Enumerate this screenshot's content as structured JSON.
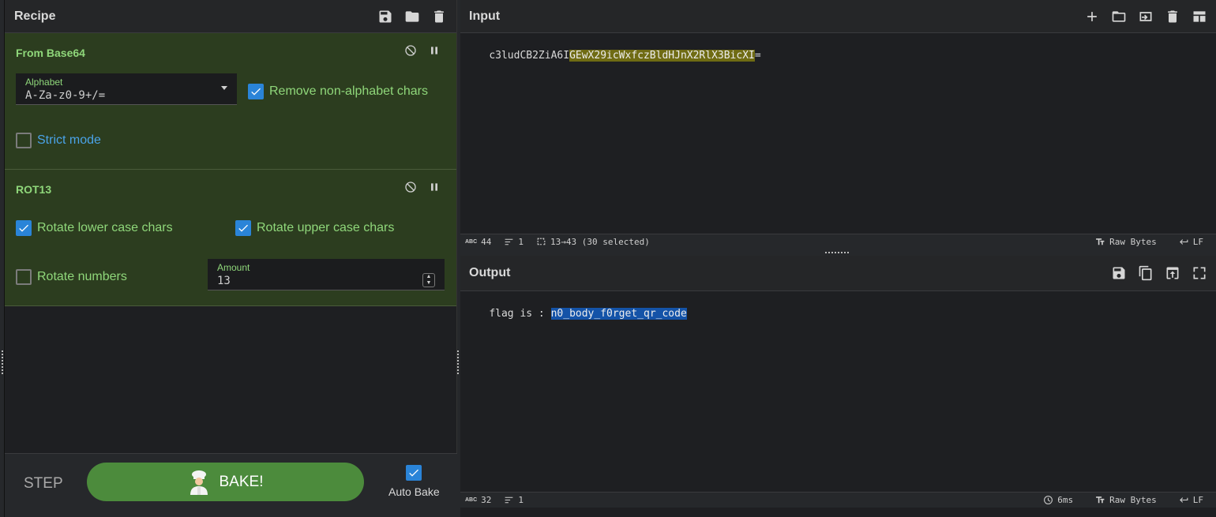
{
  "recipe": {
    "title": "Recipe",
    "operations": [
      {
        "name": "From Base64",
        "alphabet_label": "Alphabet",
        "alphabet_value": "A-Za-z0-9+/=",
        "remove_non_alpha": "Remove non-alphabet chars",
        "strict_mode": "Strict mode"
      },
      {
        "name": "ROT13",
        "rotate_lower": "Rotate lower case chars",
        "rotate_upper": "Rotate upper case chars",
        "rotate_numbers": "Rotate numbers",
        "amount_label": "Amount",
        "amount_value": "13"
      }
    ]
  },
  "bake": {
    "step_label": "STEP",
    "bake_label": "BAKE!",
    "auto_bake_label": "Auto Bake"
  },
  "input": {
    "title": "Input",
    "text_before": "c3ludCB2ZiA6I",
    "text_selected": "GEwX29icWxfczBldHJnX2RlX3BicXI",
    "text_after": "=",
    "status": {
      "length": "44",
      "lines": "1",
      "selection": "13→43 (30 selected)",
      "encoding": "Raw Bytes",
      "eol": "LF"
    }
  },
  "output": {
    "title": "Output",
    "text_before": "flag is : ",
    "text_selected": "n0_body_f0rget_qr_code",
    "status": {
      "length": "32",
      "lines": "1",
      "time": "6ms",
      "encoding": "Raw Bytes",
      "eol": "LF"
    }
  }
}
